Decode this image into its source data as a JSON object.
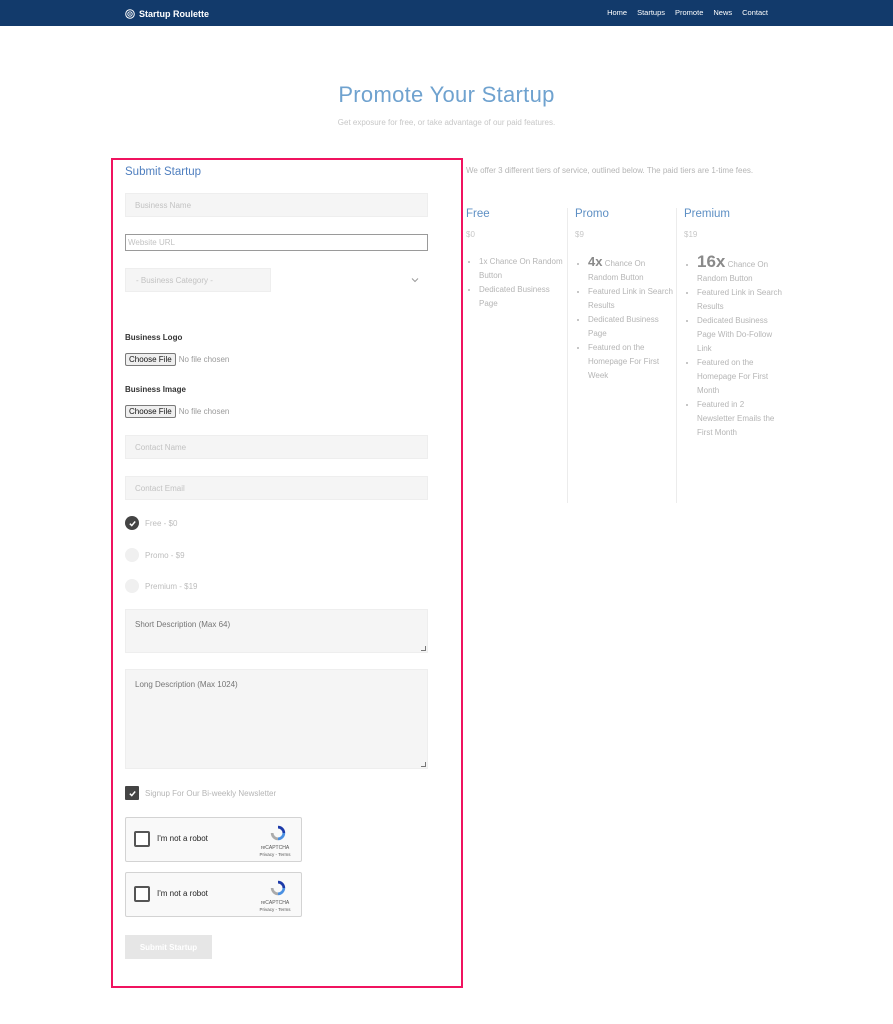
{
  "nav": {
    "brand": "Startup Roulette",
    "links": [
      "Home",
      "Startups",
      "Promote",
      "News",
      "Contact"
    ]
  },
  "hero": {
    "title": "Promote Your Startup",
    "subtitle": "Get exposure for free, or take advantage of our paid features."
  },
  "form": {
    "title": "Submit Startup",
    "business_name_placeholder": "Business Name",
    "website_url_placeholder": "Website URL",
    "category_placeholder": "- Business Category -",
    "logo_label": "Business Logo",
    "image_label": "Business Image",
    "choose_file": "Choose File",
    "no_file": "No file chosen",
    "contact_name_placeholder": "Contact Name",
    "contact_email_placeholder": "Contact Email",
    "tiers": [
      {
        "label": "Free - $0",
        "selected": true
      },
      {
        "label": "Promo - $9",
        "selected": false
      },
      {
        "label": "Premium - $19",
        "selected": false
      }
    ],
    "short_desc_placeholder": "Short Description (Max 64)",
    "long_desc_placeholder": "Long Description (Max 1024)",
    "newsletter_label": "Signup For Our Bi-weekly Newsletter",
    "newsletter_checked": true,
    "captcha": {
      "label": "I'm not a robot",
      "brand": "reCAPTCHA",
      "terms": "Privacy - Terms"
    },
    "submit_label": "Submit Startup"
  },
  "intro": "We offer 3 different tiers of service, outlined below. The paid tiers are 1-time fees.",
  "plans": [
    {
      "name": "Free",
      "price": "$0",
      "features": [
        "1x Chance On Random Button",
        "Dedicated Business Page"
      ]
    },
    {
      "name": "Promo",
      "price": "$9",
      "features": [
        "4x",
        "Chance On Random Button",
        "Featured Link in Search Results",
        "Dedicated Business Page",
        "Featured on the Homepage For First Week"
      ]
    },
    {
      "name": "Premium",
      "price": "$19",
      "features": [
        "16x",
        "Chance On Random Button",
        "Featured Link in Search Results",
        "Dedicated Business Page With Do-Follow Link",
        "Featured on the Homepage For First Month",
        "Featured in 2 Newsletter Emails the First Month"
      ]
    }
  ],
  "colors": {
    "navbar": "#123a6b",
    "accent": "#5d8fc4",
    "highlight_border": "#f0135f"
  }
}
